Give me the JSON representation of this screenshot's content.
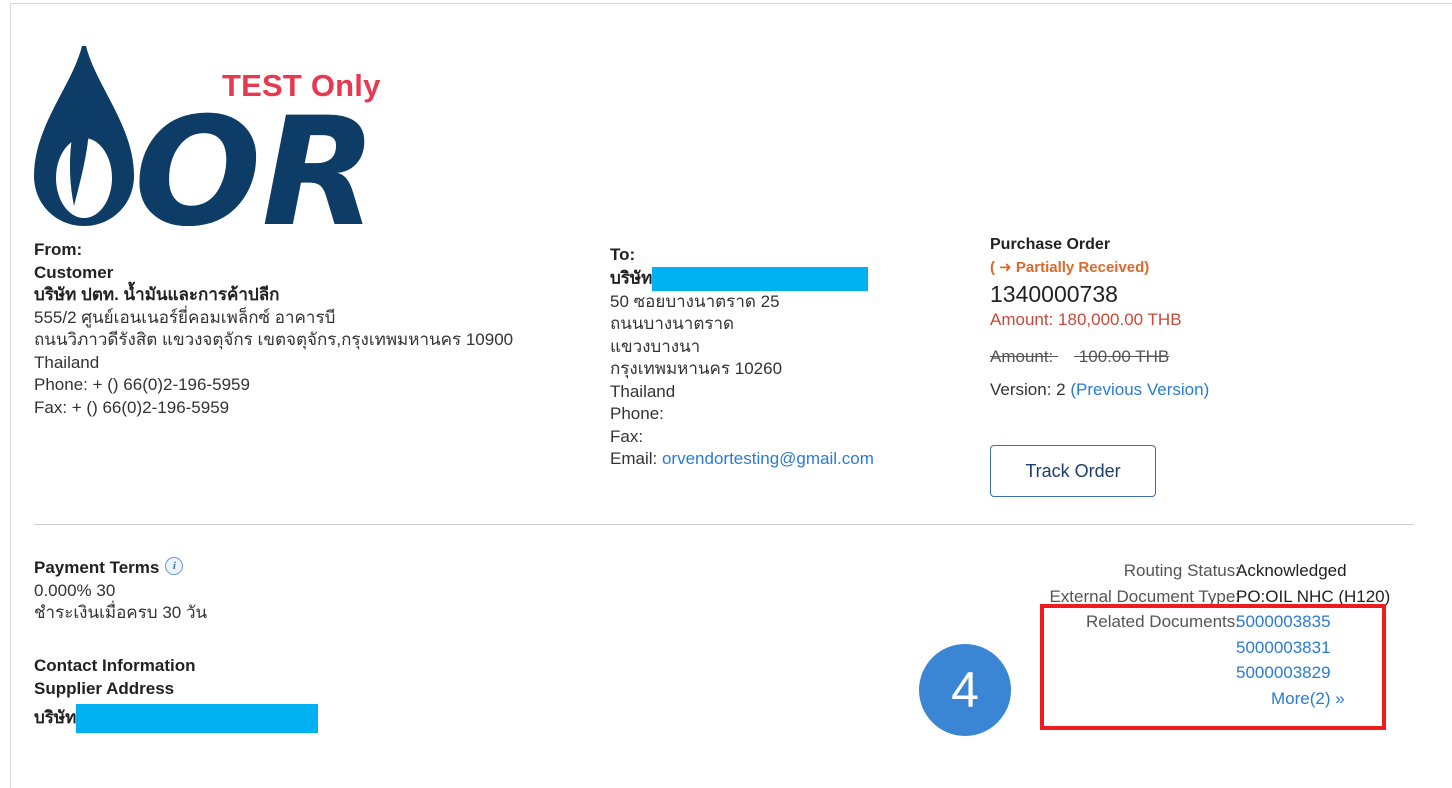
{
  "logo": {
    "badge_text": "TEST Only",
    "brand": "OR",
    "brand_color": "#0d3d66"
  },
  "from": {
    "heading": "From:",
    "type": "Customer",
    "company": "บริษัท ปตท. น้ำมันและการค้าปลีก",
    "address_lines": [
      "555/2 ศูนย์เอนเนอร์ยี่คอมเพล็กซ์ อาคารบี",
      "ถนนวิภาวดีรังสิต แขวงจตุจักร เขตจตุจักร,กรุงเทพมหานคร 10900",
      "Thailand"
    ],
    "phone": "Phone:  + () 66(0)2-196-5959",
    "fax": "Fax:  + () 66(0)2-196-5959"
  },
  "to": {
    "heading": "To:",
    "company_prefix": "บริษัท",
    "address_lines": [
      "50 ซอยบางนาตราด 25",
      "ถนนบางนาตราด",
      "แขวงบางนา",
      "กรุงเทพมหานคร 10260",
      "Thailand"
    ],
    "phone": "Phone:",
    "fax": "Fax:",
    "email_label": "Email:",
    "email": "orvendortesting@gmail.com"
  },
  "order": {
    "heading": "Purchase Order",
    "status": "( ➜ Partially Received)",
    "number": "1340000738",
    "amount": "Amount: 180,000.00 THB",
    "old_amount_label": "Amount:",
    "old_amount_value": "100.00 THB",
    "version_label": "Version: 2",
    "previous_version": "(Previous Version)",
    "track_button": "Track Order"
  },
  "payment": {
    "heading": "Payment Terms",
    "info_icon": "i",
    "terms_line": "0.000% 30",
    "terms_desc": "ชำระเงินเมื่อครบ 30 วัน"
  },
  "contact": {
    "heading": "Contact Information",
    "subheading": "Supplier Address",
    "company_prefix": "บริษัท"
  },
  "details": {
    "routing_status_label": "Routing Status:",
    "routing_status_value": "Acknowledged",
    "ext_doc_type_label": "External Document Type:",
    "ext_doc_type_value": "PO:OIL NHC (H120)",
    "related_docs_label": "Related Documents:",
    "related_docs": [
      "5000003835",
      "5000003831",
      "5000003829"
    ],
    "more_link": "More(2) »"
  },
  "annotation": {
    "step_number": "4",
    "highlight_color": "#ee1c1c",
    "badge_color": "#3a86d4"
  }
}
